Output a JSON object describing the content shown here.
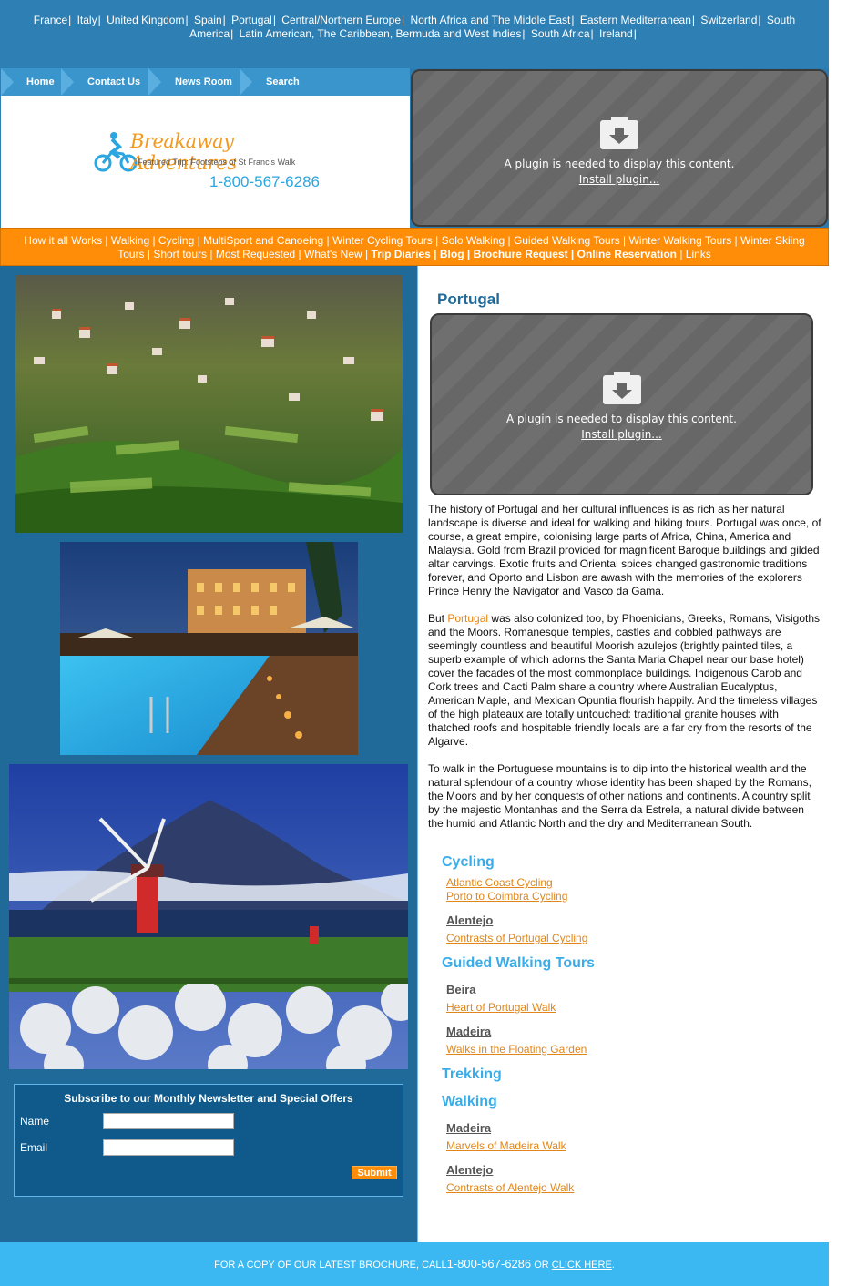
{
  "top_nav": [
    "France",
    "Italy",
    "United Kingdom",
    "Spain",
    "Portugal",
    "Central/Northern Europe",
    "North Africa and The Middle East",
    "Eastern Mediterranean",
    "Switzerland",
    "South America",
    "Latin American, The Caribbean, Bermuda and West Indies",
    "South Africa",
    "Ireland"
  ],
  "tabs": {
    "home": "Home",
    "contact": "Contact Us",
    "news": "News Room",
    "search": "Search"
  },
  "logo": {
    "name": "Breakaway Adventures",
    "tagline": "Featured Trip: Footsteps of St Francis Walk",
    "phone": "1-800-567-6286"
  },
  "plugin": {
    "message": "A plugin is needed to display this content.",
    "install": "Install plugin..."
  },
  "main_nav": [
    {
      "label": "How it all Works",
      "bold": false
    },
    {
      "label": "Walking",
      "bold": false
    },
    {
      "label": "Cycling",
      "bold": false
    },
    {
      "label": "MultiSport and Canoeing",
      "bold": false
    },
    {
      "label": "Winter Cycling Tours",
      "bold": false
    },
    {
      "label": "Solo Walking",
      "bold": false
    },
    {
      "label": "Guided Walking Tours",
      "bold": false
    },
    {
      "label": "Winter Walking Tours",
      "bold": false
    },
    {
      "label": "Winter Skiing Tours",
      "bold": false
    },
    {
      "label": "Short tours",
      "bold": false
    },
    {
      "label": "Most Requested",
      "bold": false
    },
    {
      "label": "What's New",
      "bold": false
    },
    {
      "label": "Trip Diaries",
      "bold": true
    },
    {
      "label": "Blog",
      "bold": true
    },
    {
      "label": "Brochure Request",
      "bold": true
    },
    {
      "label": "Online Reservation",
      "bold": true
    },
    {
      "label": "Links",
      "bold": false
    }
  ],
  "newsletter": {
    "title": "Subscribe to our Monthly Newsletter and Special Offers",
    "name_label": "Name",
    "email_label": "Email",
    "submit": "Submit"
  },
  "content": {
    "title": "Portugal",
    "para1": "The history of Portugal and her cultural influences is as rich as her natural landscape is diverse and ideal for walking and hiking tours. Portugal was once, of course, a great empire, colonising large parts of Africa, China, America and Malaysia. Gold from Brazil provided for magnificent Baroque buildings and gilded altar carvings. Exotic fruits and Oriental spices changed gastronomic traditions forever, and Oporto and Lisbon are awash with the memories of the explorers Prince Henry the Navigator and Vasco da Gama.",
    "para2_prefix": "But ",
    "para2_link": "Portugal",
    "para2_rest": " was also colonized too, by Phoenicians, Greeks, Romans, Visigoths and the Moors. Romanesque temples, castles and cobbled pathways are seemingly countless and beautiful Moorish azulejos (brightly painted tiles, a superb example of which adorns the Santa Maria Chapel near our base hotel) cover the facades of the most commonplace buildings. Indigenous Carob and Cork trees and Cacti Palm share a country where Australian Eucalyptus, American Maple, and Mexican Opuntia flourish happily. And the timeless villages of the high plateaux are totally untouched: traditional granite houses with thatched roofs and hospitable friendly locals are a far cry from the resorts of the Algarve.",
    "para3": "To walk in the Portuguese mountains is to dip into the historical wealth and the natural splendour of a country whose identity has been shaped by the Romans, the Moors and by her conquests of other nations and continents. A country split by the majestic Montanhas and the Serra da Estrela, a natural divide between the humid and Atlantic North and the dry and Mediterranean South."
  },
  "tours": {
    "cycling": "Cycling",
    "cycling_links": [
      "Atlantic Coast Cycling",
      "Porto to Coimbra Cycling"
    ],
    "alentejo": "Alentejo",
    "alentejo_cycling": "Contrasts of Portugal Cycling",
    "guided": "Guided Walking Tours",
    "beira": "Beira",
    "beira_link": "Heart of Portugal Walk",
    "madeira": "Madeira",
    "madeira_link": "Walks in the Floating Garden",
    "trekking": "Trekking",
    "walking": "Walking",
    "madeira2": "Madeira",
    "madeira2_link": "Marvels of Madeira Walk",
    "alentejo2": "Alentejo",
    "alentejo2_link": "Contrasts of Alentejo Walk"
  },
  "footer": {
    "prefix": "FOR A COPY OF OUR LATEST BROCHURE, CALL",
    "phone": "1-800-567-6286",
    "mid": " OR ",
    "link": "CLICK HERE",
    "suffix": "."
  }
}
